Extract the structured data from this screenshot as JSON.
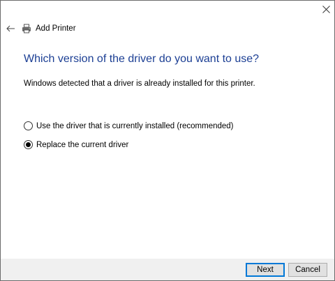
{
  "window": {
    "title": "Add Printer",
    "close_label": "×"
  },
  "main": {
    "heading": "Which version of the driver do you want to use?",
    "description": "Windows detected that a driver is already installed for this printer.",
    "options": [
      {
        "label": "Use the driver that is currently installed (recommended)",
        "selected": false
      },
      {
        "label": "Replace the current driver",
        "selected": true
      }
    ]
  },
  "footer": {
    "next_label": "Next",
    "cancel_label": "Cancel"
  },
  "colors": {
    "heading": "#1c3f94",
    "footer_bg": "#f0f0f0",
    "default_button_border": "#0078d7"
  },
  "icons": {
    "close": "close-icon",
    "back": "back-arrow-icon",
    "printer": "printer-icon"
  }
}
